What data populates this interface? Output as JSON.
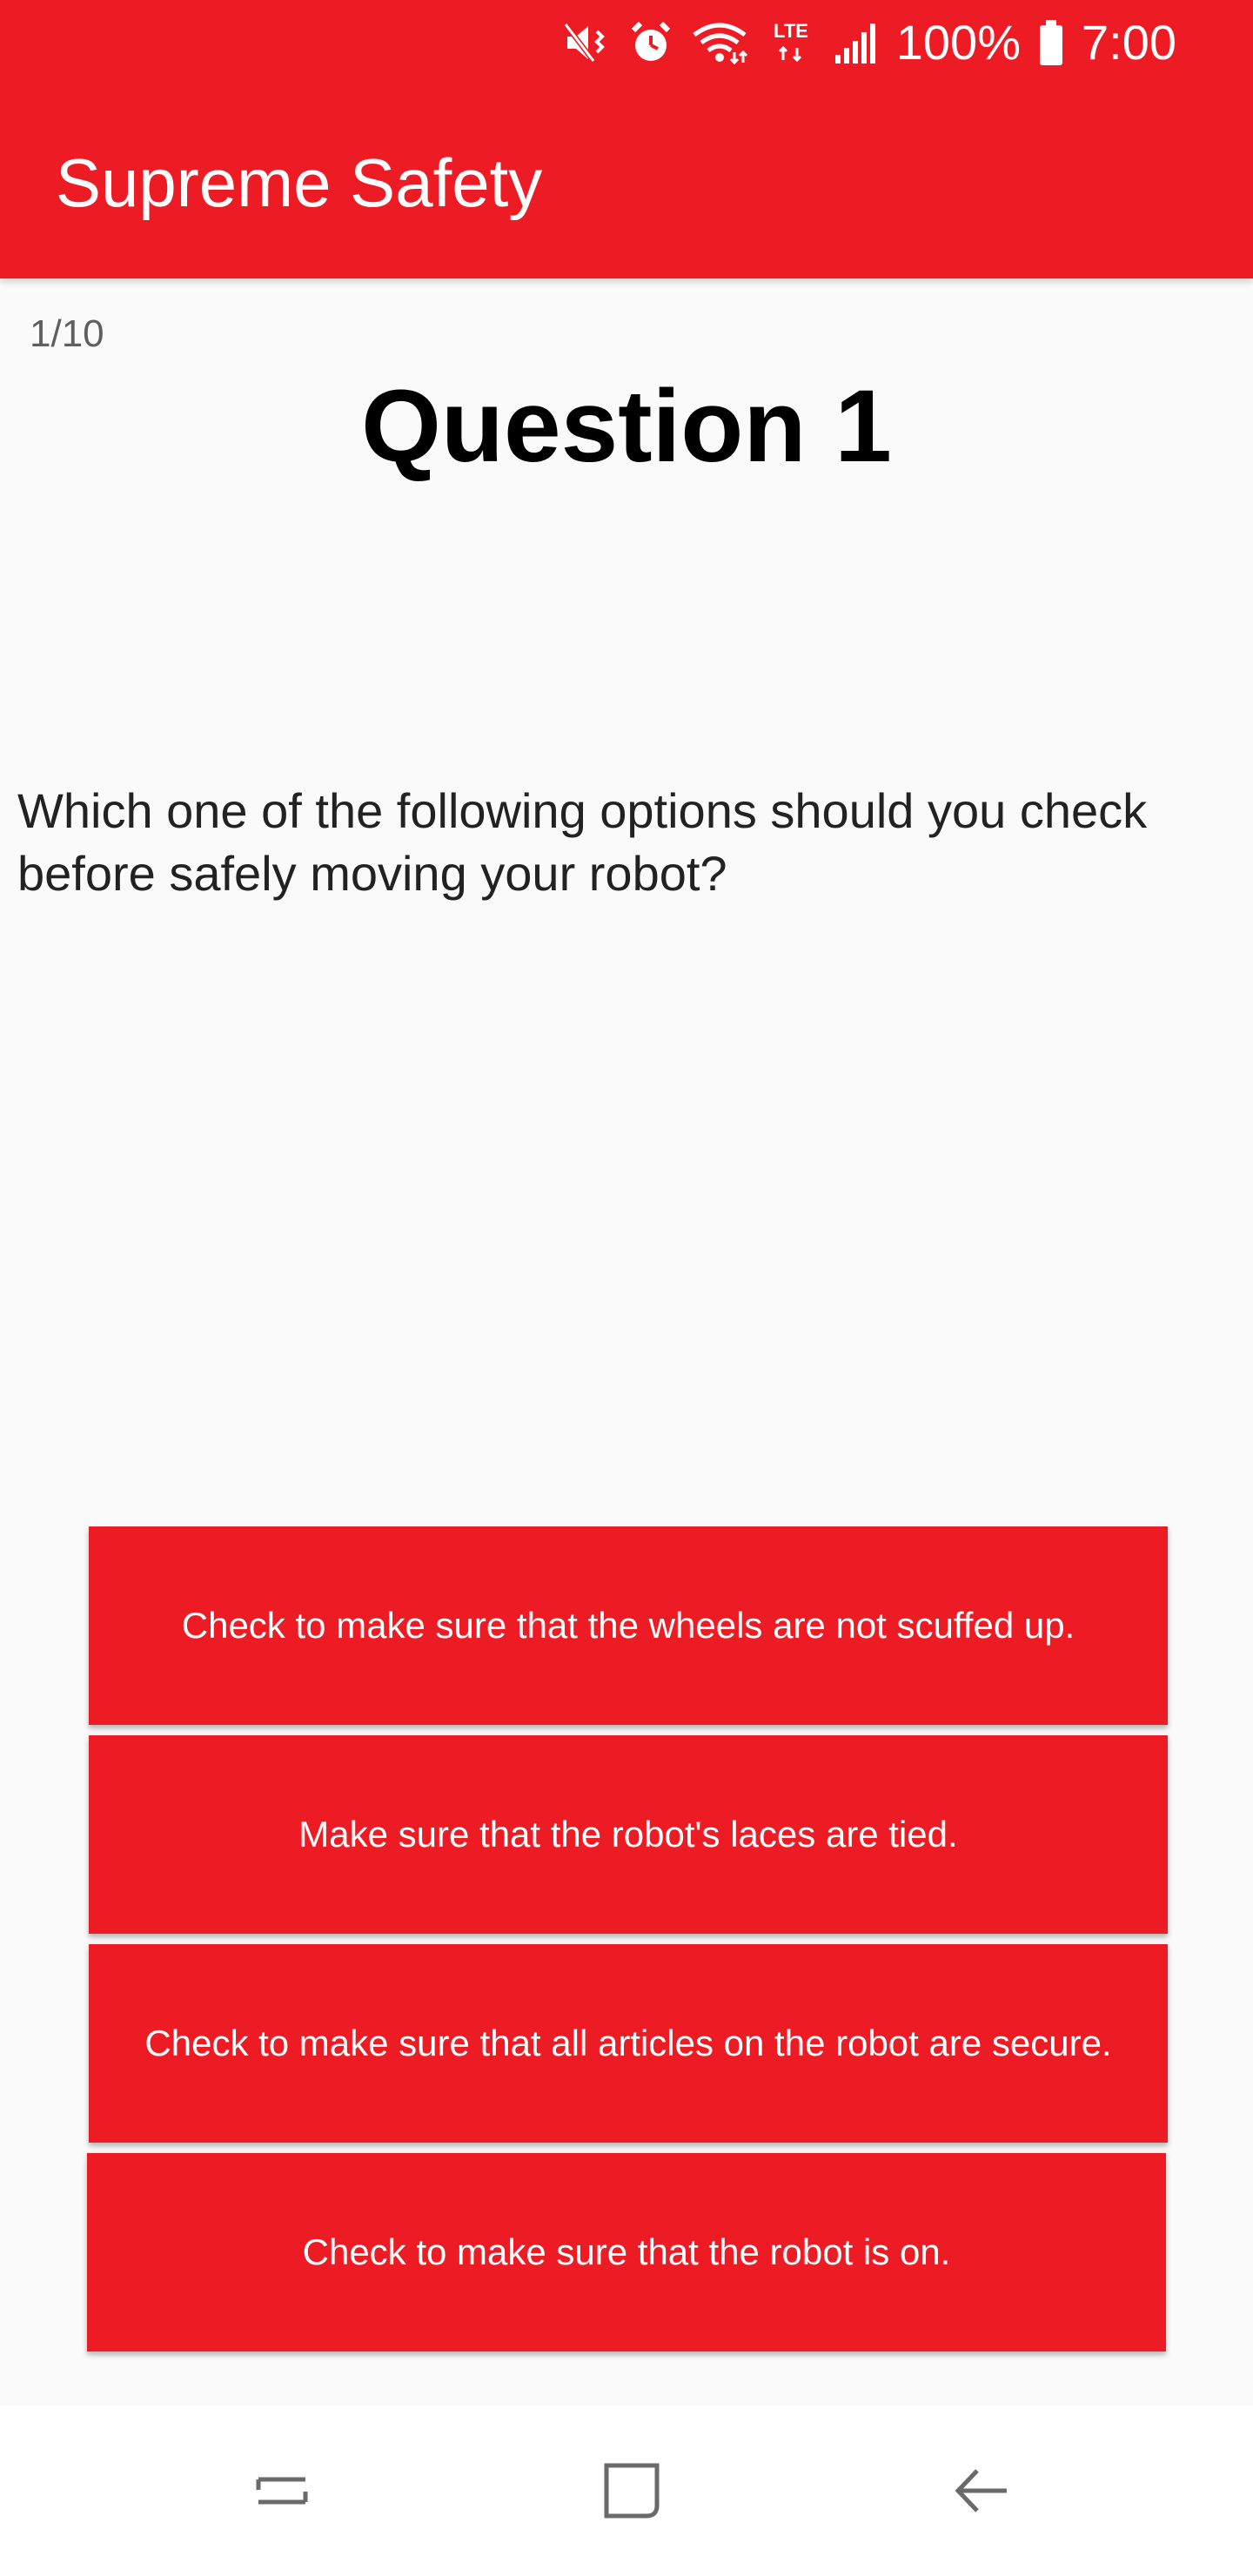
{
  "status_bar": {
    "icons": [
      "mute-icon",
      "alarm-icon",
      "wifi-icon",
      "lte-icon",
      "signal-icon"
    ],
    "lte_label": "LTE",
    "battery_percent": "100%",
    "battery_icon": "battery-icon",
    "time": "7:00"
  },
  "app_bar": {
    "title": "Supreme Safety"
  },
  "quiz": {
    "progress": "1/10",
    "question_title": "Question 1",
    "question_text": "Which one of the following options should you check before safely moving your robot?",
    "answers": [
      "Check to make sure that the wheels are not scuffed up.",
      "Make sure that the robot's laces are tied.",
      "Check to make sure that all articles on the robot are secure.",
      "Check to make sure that the robot is on."
    ]
  },
  "nav_bar": {
    "icons": [
      "recent-apps-icon",
      "home-icon",
      "back-icon"
    ]
  },
  "colors": {
    "accent": "#ed1c24",
    "background": "#fafafa",
    "button_text": "#ffffff"
  }
}
